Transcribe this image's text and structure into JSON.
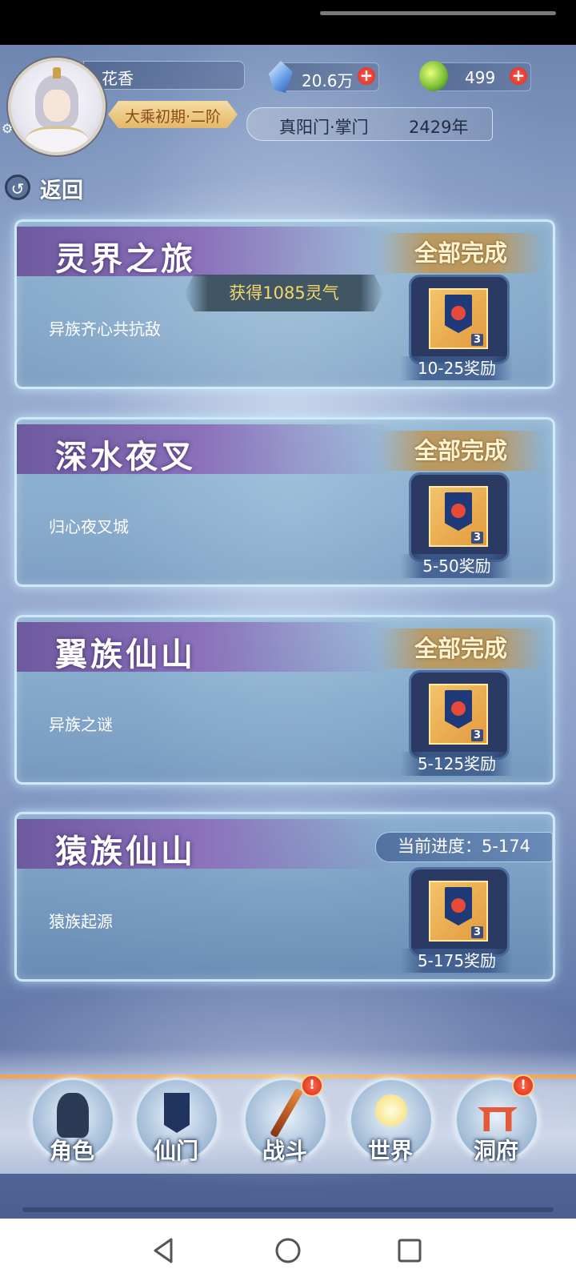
{
  "player": {
    "name": "花香",
    "rank": "大乘初期·二阶",
    "sect": "真阳门·掌门",
    "age": "2429年"
  },
  "resources": [
    {
      "icon": "spirit-crystal-icon",
      "value": "20.6万",
      "add": "+"
    },
    {
      "icon": "jade-icon",
      "value": "499",
      "add": "+"
    }
  ],
  "back": {
    "label": "返回"
  },
  "toast": "获得1085灵气",
  "cards": [
    {
      "title": "灵界之旅",
      "subtitle": "异族齐心共抗敌",
      "status": "全部完成",
      "reward_label": "10-25奖励",
      "item_count": "3"
    },
    {
      "title": "深水夜叉",
      "subtitle": "归心夜叉城",
      "status": "全部完成",
      "reward_label": "5-50奖励",
      "item_count": "3"
    },
    {
      "title": "翼族仙山",
      "subtitle": "异族之谜",
      "status": "全部完成",
      "reward_label": "5-125奖励",
      "item_count": "3"
    },
    {
      "title": "猿族仙山",
      "subtitle": "猿族起源",
      "status": "当前进度：5-174",
      "reward_label": "5-175奖励",
      "item_count": "3"
    }
  ],
  "nav": [
    {
      "label": "角色",
      "icon": "character-icon",
      "alert": ""
    },
    {
      "label": "仙门",
      "icon": "sect-banner-icon",
      "alert": ""
    },
    {
      "label": "战斗",
      "icon": "sword-icon",
      "alert": "!"
    },
    {
      "label": "世界",
      "icon": "world-icon",
      "alert": ""
    },
    {
      "label": "洞府",
      "icon": "cave-gate-icon",
      "alert": "!"
    }
  ],
  "colors": {
    "accent_gold": "#f6d86a",
    "title_purple": "#8c72bb",
    "alert_red": "#d22a1a"
  }
}
